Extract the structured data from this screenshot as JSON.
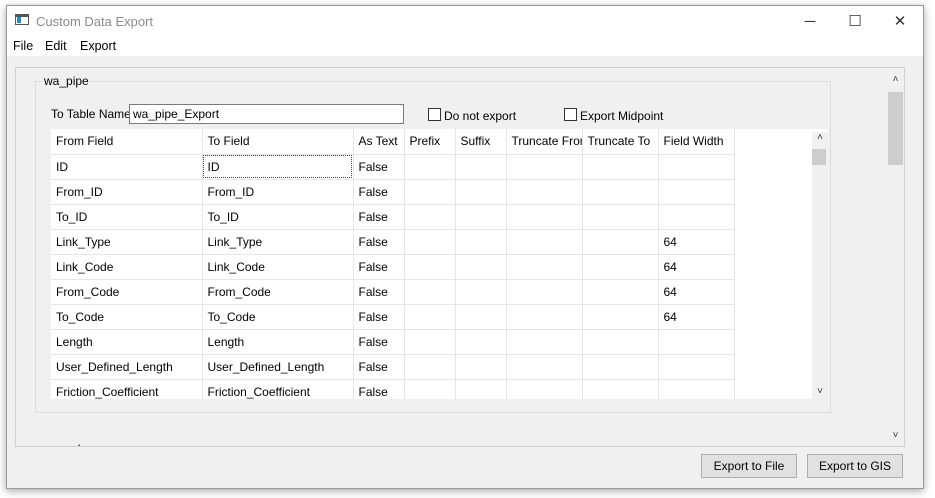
{
  "window": {
    "title": "Custom Data Export",
    "minimize_glyph": "─",
    "maximize_glyph": "☐",
    "close_glyph": "✕"
  },
  "menu": [
    "File",
    "Edit",
    "Export"
  ],
  "group": {
    "title": "wa_pipe",
    "table_name_label": "To Table Name",
    "table_name_value": "wa_pipe_Export",
    "do_not_export_label": "Do not export",
    "export_midpoint_label": "Export Midpoint"
  },
  "grid": {
    "columns": [
      "From Field",
      "To Field",
      "As Text",
      "Prefix",
      "Suffix",
      "Truncate From",
      "Truncate To",
      "Field Width"
    ],
    "rows": [
      [
        "ID",
        "ID",
        "False",
        "",
        "",
        "",
        "",
        ""
      ],
      [
        "From_ID",
        "From_ID",
        "False",
        "",
        "",
        "",
        "",
        ""
      ],
      [
        "To_ID",
        "To_ID",
        "False",
        "",
        "",
        "",
        "",
        ""
      ],
      [
        "Link_Type",
        "Link_Type",
        "False",
        "",
        "",
        "",
        "",
        "64"
      ],
      [
        "Link_Code",
        "Link_Code",
        "False",
        "",
        "",
        "",
        "",
        "64"
      ],
      [
        "From_Code",
        "From_Code",
        "False",
        "",
        "",
        "",
        "",
        "64"
      ],
      [
        "To_Code",
        "To_Code",
        "False",
        "",
        "",
        "",
        "",
        "64"
      ],
      [
        "Length",
        "Length",
        "False",
        "",
        "",
        "",
        "",
        ""
      ],
      [
        "User_Defined_Length",
        "User_Defined_Length",
        "False",
        "",
        "",
        "",
        "",
        ""
      ],
      [
        "Friction_Coefficient",
        "Friction_Coefficient",
        "False",
        "",
        "",
        "",
        "",
        ""
      ]
    ]
  },
  "group2": {
    "title": "wa_valve"
  },
  "scroll": {
    "up_glyph": "˄",
    "down_glyph": "˅"
  },
  "buttons": {
    "export_file": "Export to File",
    "export_gis": "Export to GIS"
  }
}
